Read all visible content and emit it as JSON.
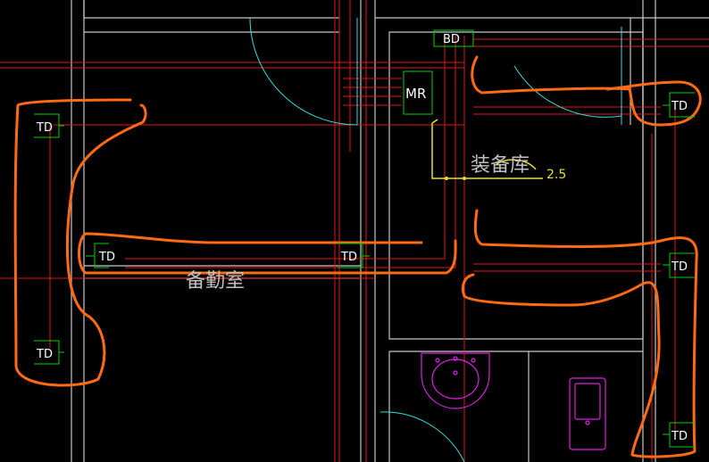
{
  "drawing": {
    "background": "#000000",
    "rooms": {
      "equipment_room": "装备库",
      "duty_room": "备勤室"
    },
    "annotations": {
      "handwritten_dimension": "2.5"
    },
    "symbols": {
      "building_distributor": "BD",
      "media_room": "MR",
      "telecom_outlets": [
        "TD",
        "TD",
        "TD",
        "TD",
        "TD",
        "TD",
        "TD"
      ]
    },
    "colors": {
      "walls": "#c8c8c8",
      "cable_lines": "#e01818",
      "door_swings": "#30e0e0",
      "markup_route": "#ff6a14",
      "sanitary": "#e020e0",
      "symbols": "#00d000",
      "annotation": "#e8e030"
    }
  }
}
